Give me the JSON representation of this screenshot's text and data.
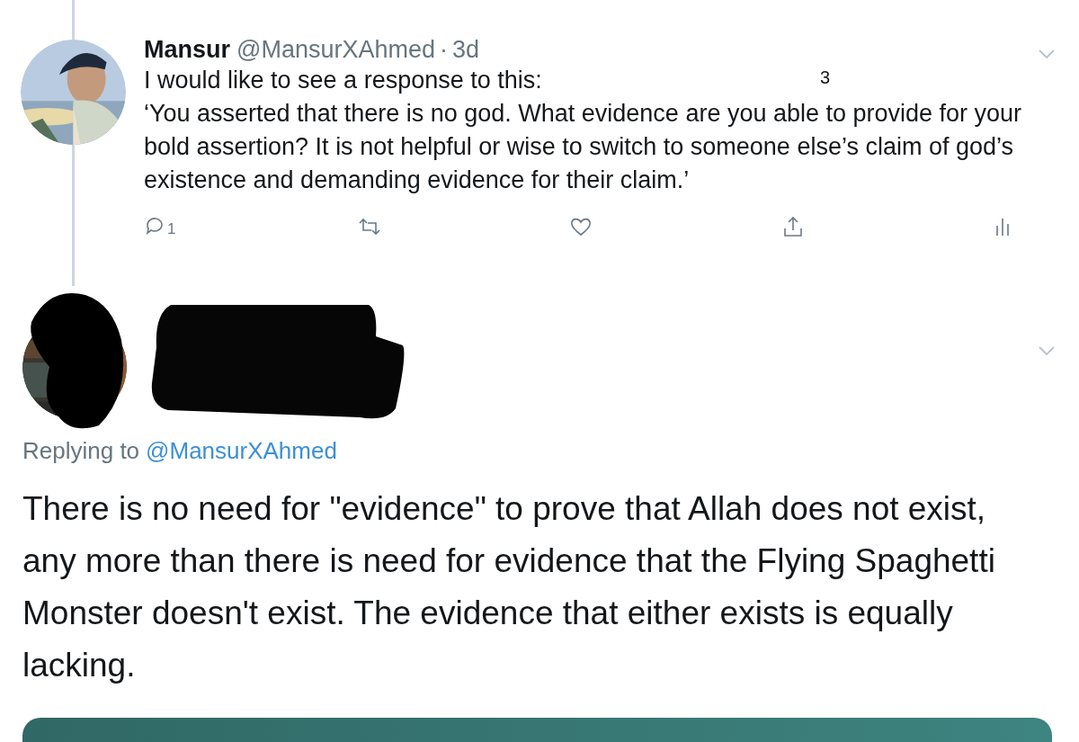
{
  "parent_tweet": {
    "name": "Mansur",
    "handle": "@MansurXAhmed",
    "separator": "·",
    "time": "3d",
    "badge": "3",
    "paragraphs": [
      "I would like to see a response to this:",
      "‘You asserted that there is no god. What evidence are you able to provide for your bold assertion? It is not helpful or wise to switch to someone else’s claim of god’s existence and demanding evidence for their claim.’"
    ],
    "actions": [
      {
        "kind": "reply",
        "count": "1"
      },
      {
        "kind": "retweet"
      },
      {
        "kind": "like"
      },
      {
        "kind": "share"
      },
      {
        "kind": "stats"
      }
    ]
  },
  "reply_tweet": {
    "replying_label": "Replying to",
    "replying_handle": "@MansurXAhmed",
    "text": "There is no need for \"evidence\" to prove that Allah does not exist, any more than there is need for evidence that the Flying Spaghetti Monster doesn't exist. The evidence that either exists is equally lacking."
  }
}
